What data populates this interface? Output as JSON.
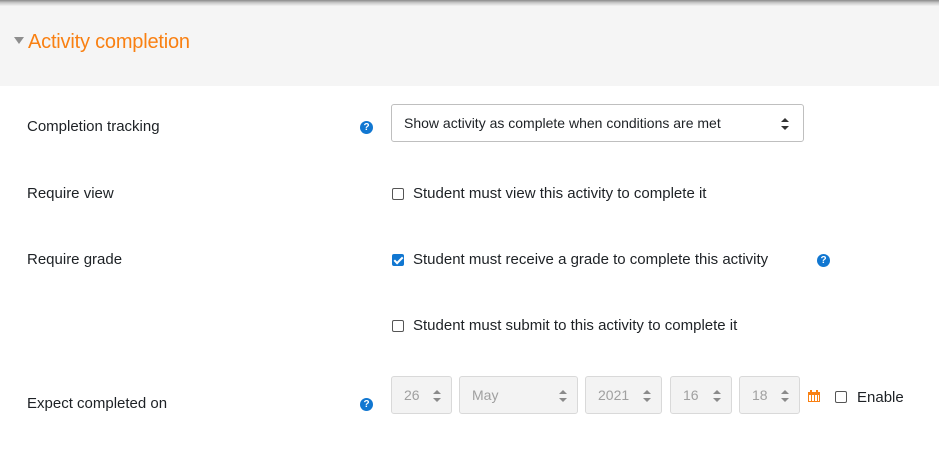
{
  "section": {
    "title": "Activity completion"
  },
  "completion_tracking": {
    "label": "Completion tracking",
    "help_icon": "question-circle-icon",
    "selected": "Show activity as complete when conditions are met"
  },
  "require_view": {
    "label": "Require view",
    "checkbox_label": "Student must view this activity to complete it",
    "checked": false
  },
  "require_grade": {
    "label": "Require grade",
    "checkbox_label": "Student must receive a grade to complete this activity",
    "checked": true,
    "help_icon": "question-circle-icon"
  },
  "require_submit": {
    "checkbox_label": "Student must submit to this activity to complete it",
    "checked": false
  },
  "expect_completed": {
    "label": "Expect completed on",
    "help_icon": "question-circle-icon",
    "day": "26",
    "month": "May",
    "year": "2021",
    "hour": "16",
    "minute": "18",
    "calendar_icon": "calendar-icon",
    "enable_label": "Enable",
    "enabled": false
  },
  "colors": {
    "accent": "#f98012",
    "primary": "#1177d1",
    "header_bg": "#f5f5f5"
  }
}
